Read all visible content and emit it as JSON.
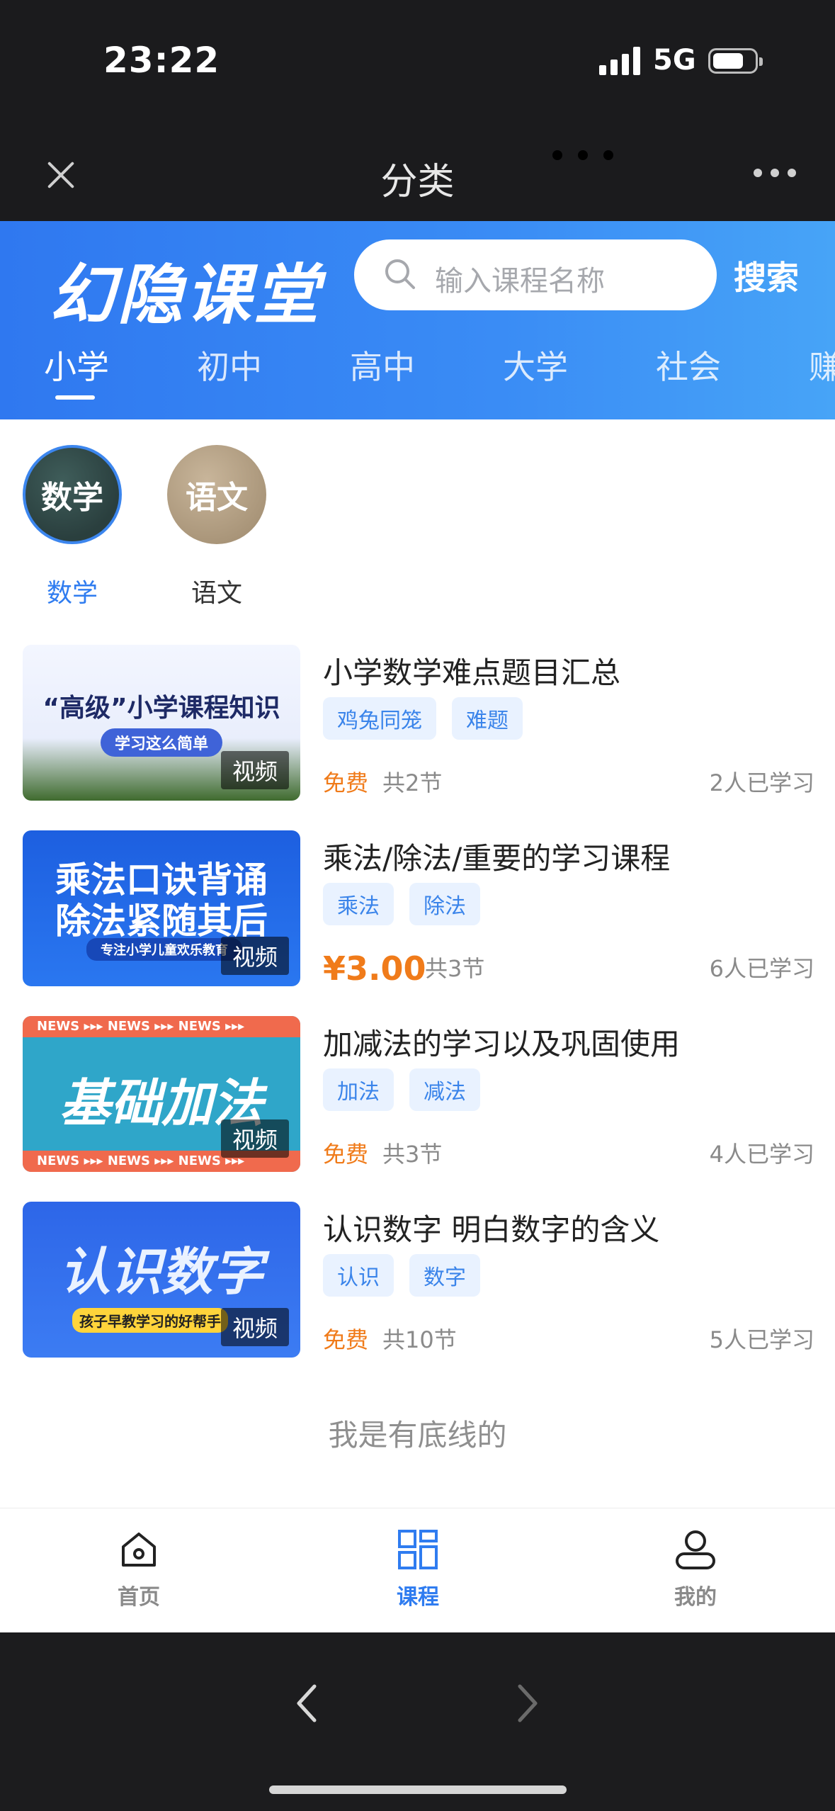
{
  "status": {
    "time": "23:22",
    "network": "5G"
  },
  "miniprogram": {
    "title": "分类"
  },
  "header": {
    "logo": "幻隐课堂",
    "search_placeholder": "输入课程名称",
    "search_button": "搜索",
    "tabs": [
      "小学",
      "初中",
      "高中",
      "大学",
      "社会",
      "赚"
    ],
    "active_tab": "小学"
  },
  "categories": [
    {
      "circle_text": "数学",
      "label": "数学",
      "active": true
    },
    {
      "circle_text": "语文",
      "label": "语文",
      "active": false
    }
  ],
  "courses": [
    {
      "thumb_title": "“高级”小学课程知识",
      "thumb_sub": "学习这么简单",
      "thumb_tag": "视频",
      "title": "小学数学难点题目汇总",
      "tags": [
        "鸡兔同笼",
        "难题"
      ],
      "price": "免费",
      "lessons": "共2节",
      "learners": "2人已学习"
    },
    {
      "thumb_title": "乘法口诀背诵",
      "thumb_title2": "除法紧随其后",
      "thumb_sub": "专注小学儿童欢乐教育",
      "thumb_tag": "视频",
      "title": "乘法/除法/重要的学习课程",
      "tags": [
        "乘法",
        "除法"
      ],
      "price": "¥3.00",
      "lessons": "共3节",
      "learners": "6人已学习"
    },
    {
      "thumb_title": "基础加法",
      "thumb_strip": "NEWS ▸▸▸ NEWS ▸▸▸ NEWS ▸▸▸",
      "thumb_tag": "视频",
      "title": "加减法的学习以及巩固使用",
      "tags": [
        "加法",
        "减法"
      ],
      "price": "免费",
      "lessons": "共3节",
      "learners": "4人已学习"
    },
    {
      "thumb_title": "认识数字",
      "thumb_sub": "孩子早教学习的好帮手",
      "thumb_tag": "视频",
      "title": "认识数字 明白数字的含义",
      "tags": [
        "认识",
        "数字"
      ],
      "price": "免费",
      "lessons": "共10节",
      "learners": "5人已学习"
    }
  ],
  "footer_note": "我是有底线的",
  "bottom_nav": [
    {
      "label": "首页",
      "icon": "home-icon"
    },
    {
      "label": "课程",
      "icon": "grid-icon",
      "active": true
    },
    {
      "label": "我的",
      "icon": "user-icon"
    }
  ],
  "colors": {
    "brand_blue": "#2f7cf0",
    "price_orange": "#f07b1a",
    "tag_bg": "#e9f2ff"
  }
}
